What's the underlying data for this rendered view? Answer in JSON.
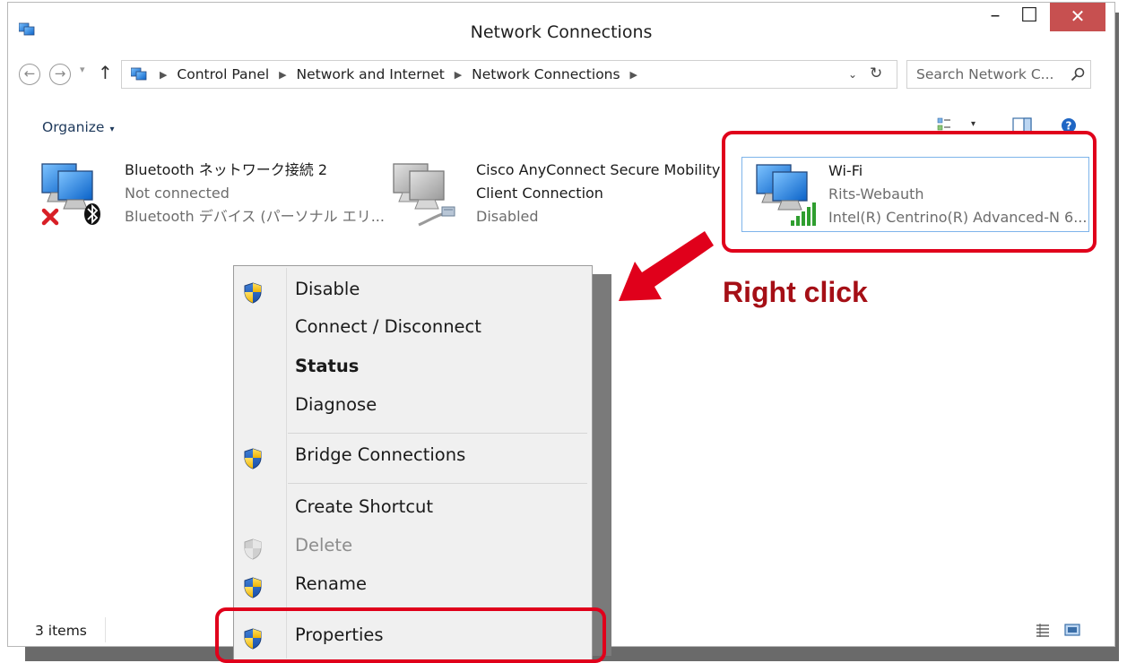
{
  "window": {
    "title": "Network Connections",
    "controls": {
      "minimize": "–",
      "maximize": "☐",
      "close": "✕"
    }
  },
  "nav": {
    "back": "←",
    "forward": "→",
    "dropdown": "▾",
    "up": "↑"
  },
  "address": {
    "crumbs": [
      "Control Panel",
      "Network and Internet",
      "Network Connections"
    ],
    "separator": "▶",
    "dropdown": "⌄",
    "refresh": "↻"
  },
  "search": {
    "placeholder": "Search Network C..."
  },
  "toolbar": {
    "organize": "Organize",
    "organize_arrow": "▾",
    "views_arrow": "▾"
  },
  "connections": [
    {
      "name": "Bluetooth ネットワーク接続 2",
      "status": "Not connected",
      "device": "Bluetooth デバイス (パーソナル エリ..."
    },
    {
      "name": "Cisco AnyConnect Secure Mobility",
      "name2": "Client Connection",
      "status": "Disabled"
    },
    {
      "name": "Wi-Fi",
      "status": "Rits-Webauth",
      "device": "Intel(R) Centrino(R) Advanced-N 6..."
    }
  ],
  "context_menu": {
    "items": [
      {
        "label": "Disable"
      },
      {
        "label": "Connect / Disconnect"
      },
      {
        "label": "Status"
      },
      {
        "label": "Diagnose"
      },
      {
        "label": "Bridge Connections"
      },
      {
        "label": "Create Shortcut"
      },
      {
        "label": "Delete"
      },
      {
        "label": "Rename"
      },
      {
        "label": "Properties"
      }
    ]
  },
  "annotation": {
    "label": "Right click",
    "color": "#e0001b"
  },
  "status_bar": {
    "items_count": "3 items"
  }
}
